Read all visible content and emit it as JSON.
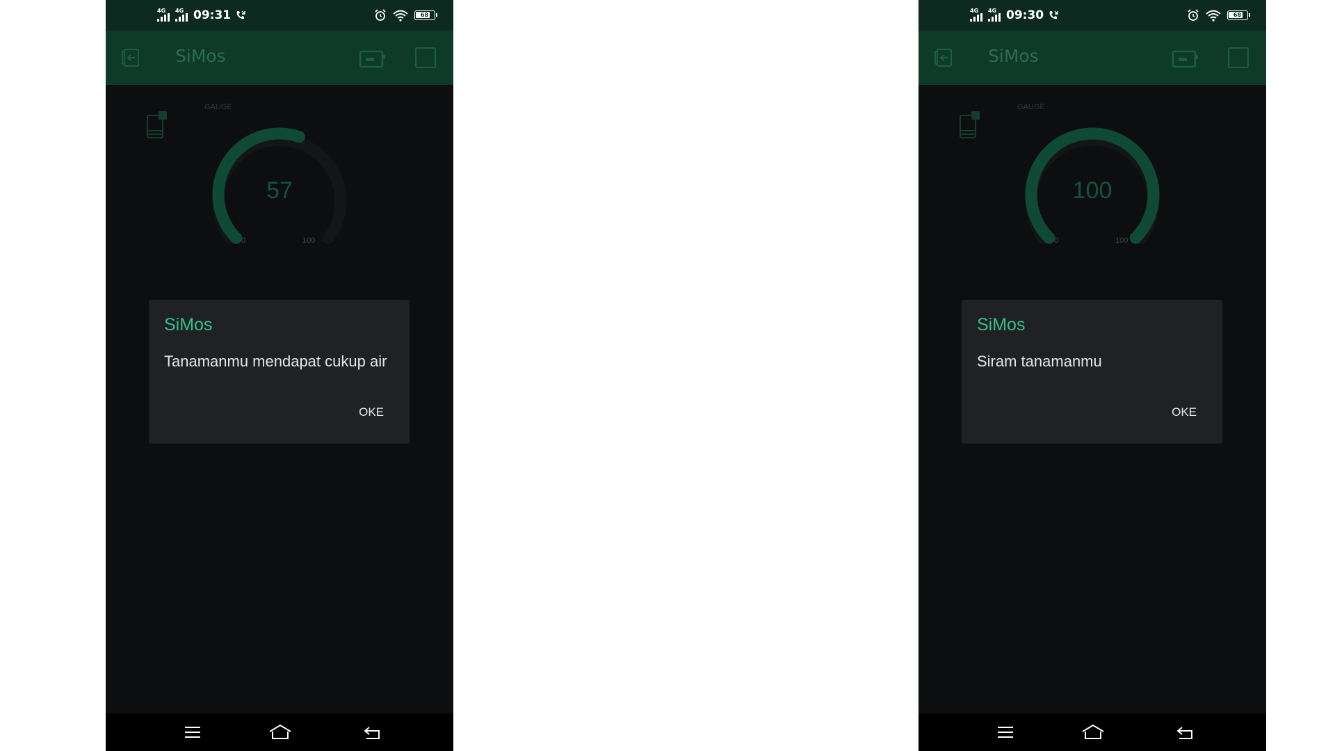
{
  "colors": {
    "status_bar_bg": "#0c2a1f",
    "app_bar_bg": "#0e3a2a",
    "screen_bg": "#0d0e10",
    "gauge_fill": "#0f4a35",
    "gauge_track": "#131517",
    "dialog_bg": "#202124",
    "dialog_title": "#35c08a"
  },
  "screens": [
    {
      "status": {
        "network_left": "4G",
        "network_right": "4G",
        "time": "09:31",
        "battery": "68"
      },
      "app_title": "SiMos",
      "gauge": {
        "label": "GAUGE",
        "value": "57",
        "min": "0",
        "max": "100",
        "level": 57
      },
      "dialog": {
        "title": "SiMos",
        "message": "Tanamanmu mendapat cukup air",
        "button": "OKE"
      }
    },
    {
      "status": {
        "network_left": "4G",
        "network_right": "4G",
        "time": "09:30",
        "battery": "68"
      },
      "app_title": "SiMos",
      "gauge": {
        "label": "GAUGE",
        "value": "100",
        "min": "0",
        "max": "100",
        "level": 100
      },
      "dialog": {
        "title": "SiMos",
        "message": "Siram tanamanmu",
        "button": "OKE"
      }
    }
  ],
  "icons": {
    "back": "back-exit-icon",
    "device": "device-icon",
    "square": "square-icon",
    "widget": "widget-box-icon",
    "alarm": "alarm-icon",
    "wifi": "wifi-icon",
    "battery": "battery-icon",
    "call": "call-icon",
    "menu": "menu-icon",
    "home": "home-icon",
    "back_nav": "back-arrow-icon"
  }
}
